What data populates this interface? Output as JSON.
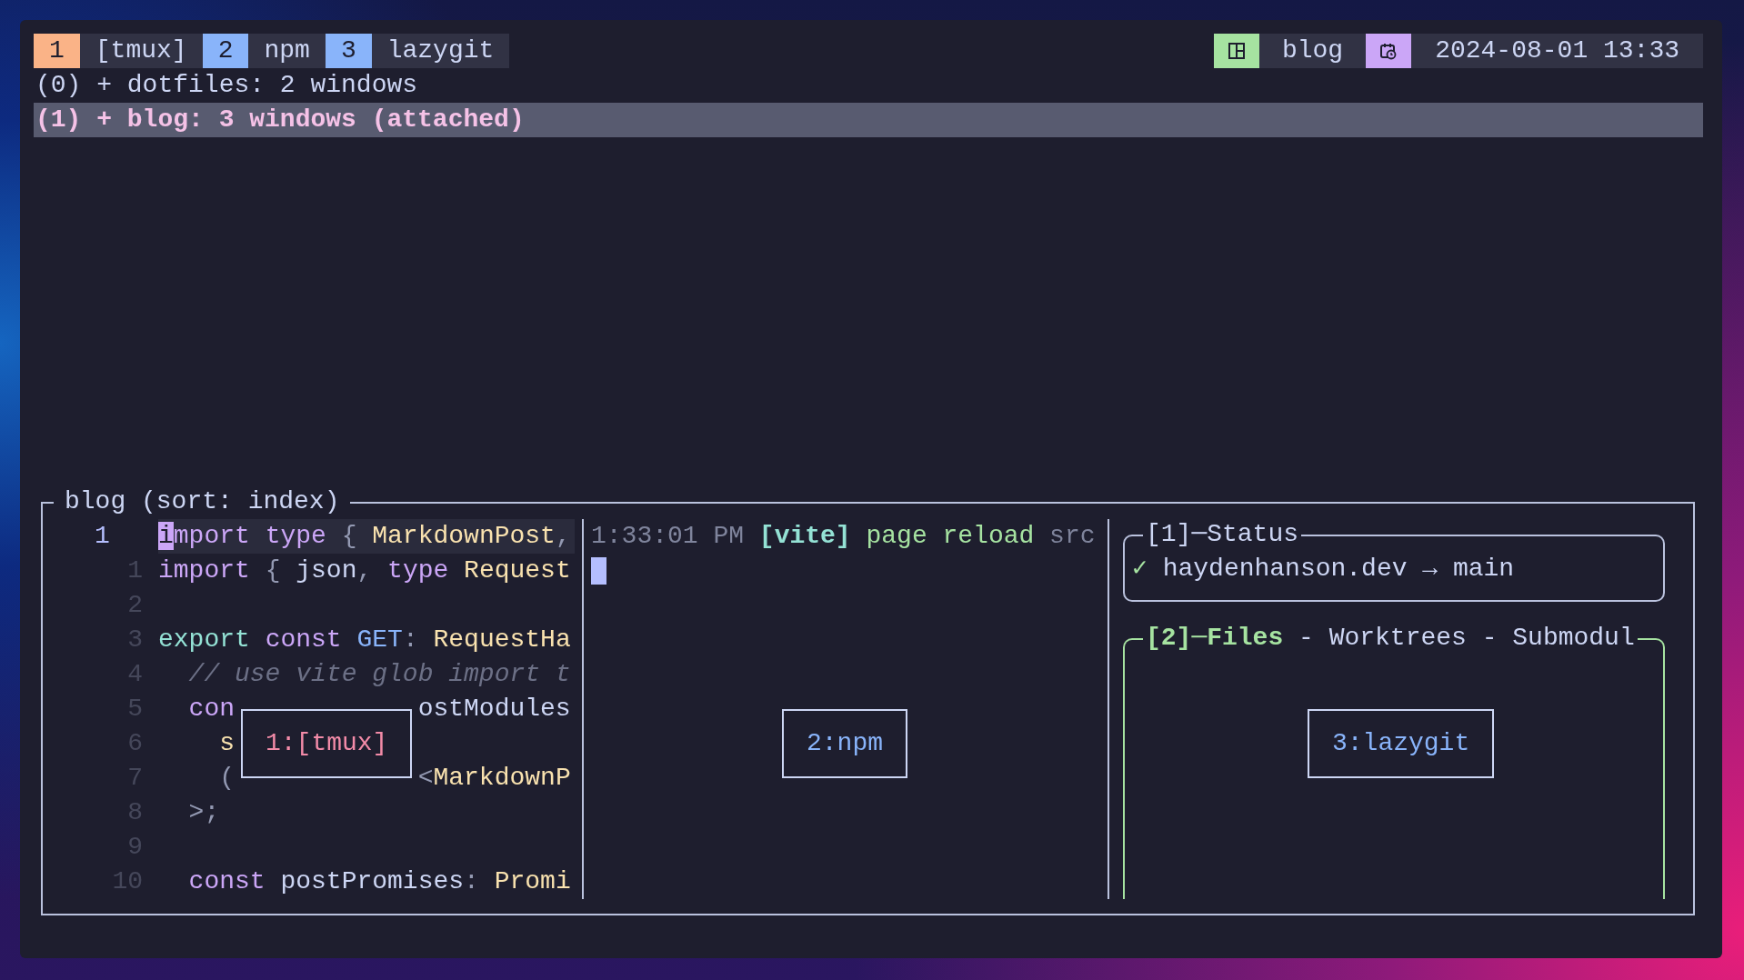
{
  "status_bar": {
    "windows": [
      {
        "number": "1",
        "name": "[tmux]",
        "selected": true
      },
      {
        "number": "2",
        "name": "npm",
        "selected": false
      },
      {
        "number": "3",
        "name": "lazygit",
        "selected": false
      }
    ],
    "session": "blog",
    "clock": "2024-08-01 13:33"
  },
  "sessions": [
    {
      "text": "(0) + dotfiles: 2 windows",
      "selected": false
    },
    {
      "text": "(1) + blog: 3 windows (attached)",
      "selected": true
    }
  ],
  "preview": {
    "title": "blog (sort: index)",
    "code_lines": [
      {
        "number": "1",
        "current": true,
        "tokens": [
          {
            "text": "i",
            "kind": "cursor"
          },
          {
            "text": "mport type",
            "kind": "keyword"
          },
          {
            "text": " { ",
            "kind": "punct"
          },
          {
            "text": "MarkdownPost",
            "kind": "type"
          },
          {
            "text": ",",
            "kind": "punct"
          }
        ]
      },
      {
        "number": "1",
        "current": false,
        "tokens": [
          {
            "text": "import",
            "kind": "keyword"
          },
          {
            "text": " { ",
            "kind": "punct"
          },
          {
            "text": "json",
            "kind": "plain"
          },
          {
            "text": ", ",
            "kind": "punct"
          },
          {
            "text": "type ",
            "kind": "keyword"
          },
          {
            "text": "Request",
            "kind": "type"
          }
        ]
      },
      {
        "number": "2",
        "current": false
      },
      {
        "number": "3",
        "current": false,
        "tokens": [
          {
            "text": "export ",
            "kind": "storage"
          },
          {
            "text": "const ",
            "kind": "keyword"
          },
          {
            "text": "GET",
            "kind": "constant"
          },
          {
            "text": ": ",
            "kind": "punct"
          },
          {
            "text": "RequestHa",
            "kind": "type"
          }
        ]
      },
      {
        "number": "4",
        "current": false,
        "tokens": [
          {
            "text": "  // use vite glob import t",
            "kind": "comment"
          }
        ]
      },
      {
        "number": "5",
        "current": false,
        "tokens": [
          {
            "text": "  con",
            "kind": "keyword"
          },
          {
            "text": "            ostModules",
            "kind": "plain"
          }
        ]
      },
      {
        "number": "6",
        "current": false,
        "tokens": [
          {
            "text": "    s",
            "kind": "type"
          }
        ]
      },
      {
        "number": "7",
        "current": false,
        "tokens": [
          {
            "text": "    (            <",
            "kind": "punct"
          },
          {
            "text": "MarkdownP",
            "kind": "type"
          }
        ]
      },
      {
        "number": "8",
        "current": false,
        "tokens": [
          {
            "text": "  >;",
            "kind": "punct"
          }
        ]
      },
      {
        "number": "9",
        "current": false
      },
      {
        "number": "10",
        "current": false,
        "tokens": [
          {
            "text": "  const",
            "kind": "keyword"
          },
          {
            "text": " postPromises",
            "kind": "plain"
          },
          {
            "text": ":",
            "kind": "punct"
          },
          {
            "text": " Promi",
            "kind": "type"
          }
        ]
      }
    ],
    "terminal": {
      "lines": [
        {
          "tokens": [
            {
              "text": "1:33:01 PM ",
              "kind": "time"
            },
            {
              "text": "[vite]",
              "kind": "tag"
            },
            {
              "text": " page reload ",
              "kind": "message"
            },
            {
              "text": "src",
              "kind": "time"
            }
          ]
        }
      ],
      "cursor_visible": true
    },
    "lazygit": [
      {
        "title": "[1]─Status",
        "focused": false,
        "check": "✓",
        "text": "haydenhanson.dev → main"
      },
      {
        "title": "[2]─Files",
        "title_rest": " - Worktrees - Submodul",
        "focused": true
      }
    ],
    "pane_labels": [
      {
        "text": "1:[tmux]",
        "selected": true
      },
      {
        "text": "2:npm",
        "selected": false
      },
      {
        "text": "3:lazygit",
        "selected": false
      }
    ]
  }
}
